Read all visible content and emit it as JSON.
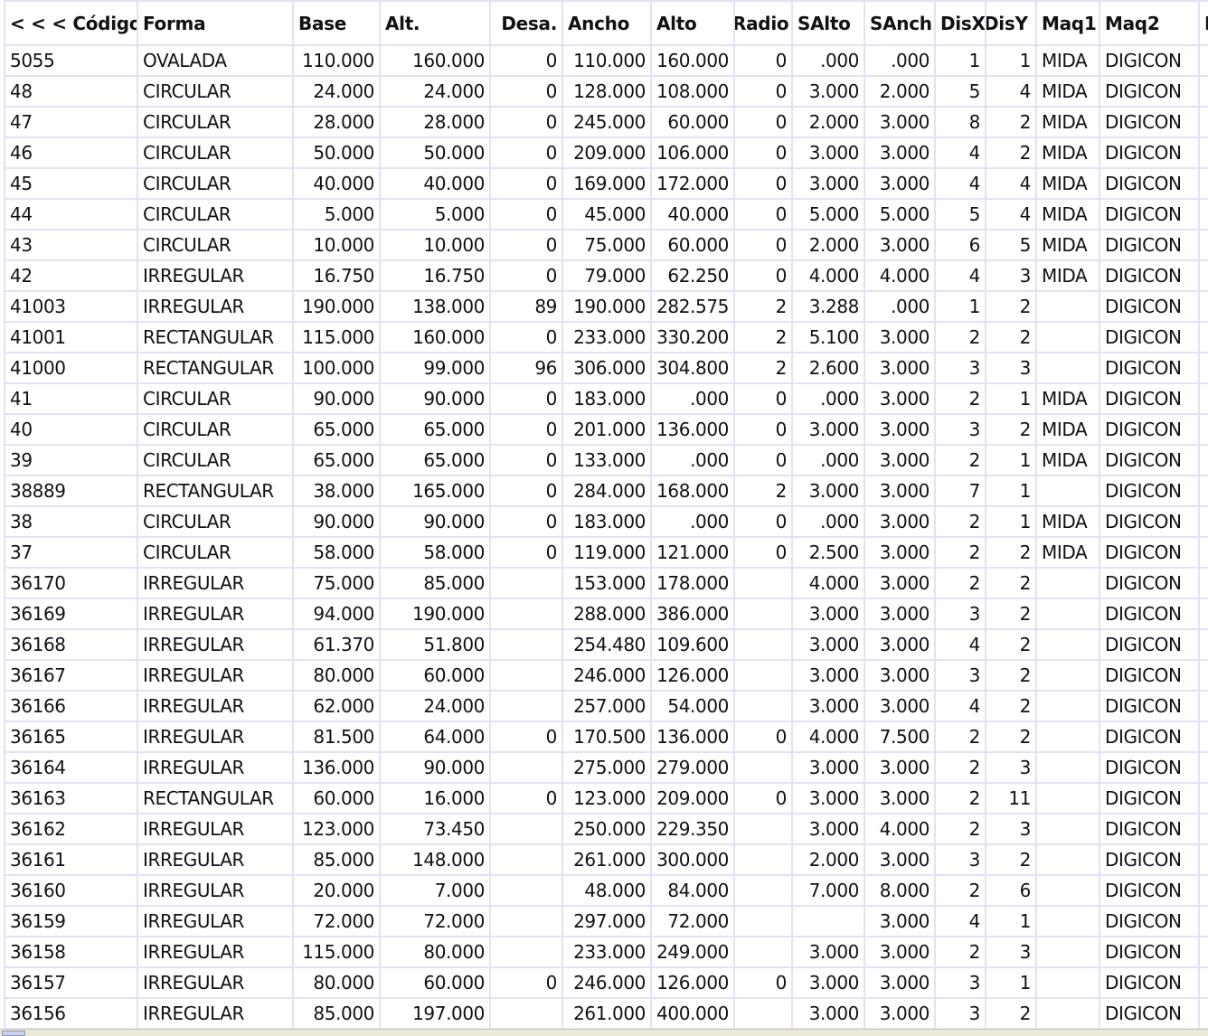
{
  "grid": {
    "columns": [
      {
        "label": "< < < Código",
        "align": "left"
      },
      {
        "label": "Forma",
        "align": "left"
      },
      {
        "label": "Base",
        "align": "left"
      },
      {
        "label": "Alt.",
        "align": "left"
      },
      {
        "label": "Desa.",
        "align": "right"
      },
      {
        "label": "Ancho",
        "align": "left"
      },
      {
        "label": "Alto",
        "align": "left"
      },
      {
        "label": "Radio",
        "align": "left"
      },
      {
        "label": "SAlto",
        "align": "left"
      },
      {
        "label": "SAnch",
        "align": "left"
      },
      {
        "label": "DisX",
        "align": "left"
      },
      {
        "label": "DisY",
        "align": "left"
      },
      {
        "label": "Maq1",
        "align": "left"
      },
      {
        "label": "Maq2",
        "align": "left"
      },
      {
        "label": "M",
        "align": "left"
      }
    ],
    "rows": [
      [
        "5055",
        "OVALADA",
        "110.000",
        "160.000",
        "0",
        "110.000",
        "160.000",
        "0",
        ".000",
        ".000",
        "1",
        "1",
        "MIDA",
        "DIGICON",
        ""
      ],
      [
        "48",
        "CIRCULAR",
        "24.000",
        "24.000",
        "0",
        "128.000",
        "108.000",
        "0",
        "3.000",
        "2.000",
        "5",
        "4",
        "MIDA",
        "DIGICON",
        ""
      ],
      [
        "47",
        "CIRCULAR",
        "28.000",
        "28.000",
        "0",
        "245.000",
        "60.000",
        "0",
        "2.000",
        "3.000",
        "8",
        "2",
        "MIDA",
        "DIGICON",
        ""
      ],
      [
        "46",
        "CIRCULAR",
        "50.000",
        "50.000",
        "0",
        "209.000",
        "106.000",
        "0",
        "3.000",
        "3.000",
        "4",
        "2",
        "MIDA",
        "DIGICON",
        ""
      ],
      [
        "45",
        "CIRCULAR",
        "40.000",
        "40.000",
        "0",
        "169.000",
        "172.000",
        "0",
        "3.000",
        "3.000",
        "4",
        "4",
        "MIDA",
        "DIGICON",
        ""
      ],
      [
        "44",
        "CIRCULAR",
        "5.000",
        "5.000",
        "0",
        "45.000",
        "40.000",
        "0",
        "5.000",
        "5.000",
        "5",
        "4",
        "MIDA",
        "DIGICON",
        ""
      ],
      [
        "43",
        "CIRCULAR",
        "10.000",
        "10.000",
        "0",
        "75.000",
        "60.000",
        "0",
        "2.000",
        "3.000",
        "6",
        "5",
        "MIDA",
        "DIGICON",
        ""
      ],
      [
        "42",
        "IRREGULAR",
        "16.750",
        "16.750",
        "0",
        "79.000",
        "62.250",
        "0",
        "4.000",
        "4.000",
        "4",
        "3",
        "MIDA",
        "DIGICON",
        ""
      ],
      [
        "41003",
        "IRREGULAR",
        "190.000",
        "138.000",
        "89",
        "190.000",
        "282.575",
        "2",
        "3.288",
        ".000",
        "1",
        "2",
        "",
        "DIGICON",
        ""
      ],
      [
        "41001",
        "RECTANGULAR",
        "115.000",
        "160.000",
        "0",
        "233.000",
        "330.200",
        "2",
        "5.100",
        "3.000",
        "2",
        "2",
        "",
        "DIGICON",
        ""
      ],
      [
        "41000",
        "RECTANGULAR",
        "100.000",
        "99.000",
        "96",
        "306.000",
        "304.800",
        "2",
        "2.600",
        "3.000",
        "3",
        "3",
        "",
        "DIGICON",
        ""
      ],
      [
        "41",
        "CIRCULAR",
        "90.000",
        "90.000",
        "0",
        "183.000",
        ".000",
        "0",
        ".000",
        "3.000",
        "2",
        "1",
        "MIDA",
        "DIGICON",
        ""
      ],
      [
        "40",
        "CIRCULAR",
        "65.000",
        "65.000",
        "0",
        "201.000",
        "136.000",
        "0",
        "3.000",
        "3.000",
        "3",
        "2",
        "MIDA",
        "DIGICON",
        ""
      ],
      [
        "39",
        "CIRCULAR",
        "65.000",
        "65.000",
        "0",
        "133.000",
        ".000",
        "0",
        ".000",
        "3.000",
        "2",
        "1",
        "MIDA",
        "DIGICON",
        ""
      ],
      [
        "38889",
        "RECTANGULAR",
        "38.000",
        "165.000",
        "0",
        "284.000",
        "168.000",
        "2",
        "3.000",
        "3.000",
        "7",
        "1",
        "",
        "DIGICON",
        ""
      ],
      [
        "38",
        "CIRCULAR",
        "90.000",
        "90.000",
        "0",
        "183.000",
        ".000",
        "0",
        ".000",
        "3.000",
        "2",
        "1",
        "MIDA",
        "DIGICON",
        ""
      ],
      [
        "37",
        "CIRCULAR",
        "58.000",
        "58.000",
        "0",
        "119.000",
        "121.000",
        "0",
        "2.500",
        "3.000",
        "2",
        "2",
        "MIDA",
        "DIGICON",
        ""
      ],
      [
        "36170",
        "IRREGULAR",
        "75.000",
        "85.000",
        "",
        "153.000",
        "178.000",
        "",
        "4.000",
        "3.000",
        "2",
        "2",
        "",
        "DIGICON",
        ""
      ],
      [
        "36169",
        "IRREGULAR",
        "94.000",
        "190.000",
        "",
        "288.000",
        "386.000",
        "",
        "3.000",
        "3.000",
        "3",
        "2",
        "",
        "DIGICON",
        ""
      ],
      [
        "36168",
        "IRREGULAR",
        "61.370",
        "51.800",
        "",
        "254.480",
        "109.600",
        "",
        "3.000",
        "3.000",
        "4",
        "2",
        "",
        "DIGICON",
        ""
      ],
      [
        "36167",
        "IRREGULAR",
        "80.000",
        "60.000",
        "",
        "246.000",
        "126.000",
        "",
        "3.000",
        "3.000",
        "3",
        "2",
        "",
        "DIGICON",
        ""
      ],
      [
        "36166",
        "IRREGULAR",
        "62.000",
        "24.000",
        "",
        "257.000",
        "54.000",
        "",
        "3.000",
        "3.000",
        "4",
        "2",
        "",
        "DIGICON",
        ""
      ],
      [
        "36165",
        "IRREGULAR",
        "81.500",
        "64.000",
        "0",
        "170.500",
        "136.000",
        "0",
        "4.000",
        "7.500",
        "2",
        "2",
        "",
        "DIGICON",
        ""
      ],
      [
        "36164",
        "IRREGULAR",
        "136.000",
        "90.000",
        "",
        "275.000",
        "279.000",
        "",
        "3.000",
        "3.000",
        "2",
        "3",
        "",
        "DIGICON",
        ""
      ],
      [
        "36163",
        "RECTANGULAR",
        "60.000",
        "16.000",
        "0",
        "123.000",
        "209.000",
        "0",
        "3.000",
        "3.000",
        "2",
        "11",
        "",
        "DIGICON",
        ""
      ],
      [
        "36162",
        "IRREGULAR",
        "123.000",
        "73.450",
        "",
        "250.000",
        "229.350",
        "",
        "3.000",
        "4.000",
        "2",
        "3",
        "",
        "DIGICON",
        ""
      ],
      [
        "36161",
        "IRREGULAR",
        "85.000",
        "148.000",
        "",
        "261.000",
        "300.000",
        "",
        "2.000",
        "3.000",
        "3",
        "2",
        "",
        "DIGICON",
        ""
      ],
      [
        "36160",
        "IRREGULAR",
        "20.000",
        "7.000",
        "",
        "48.000",
        "84.000",
        "",
        "7.000",
        "8.000",
        "2",
        "6",
        "",
        "DIGICON",
        ""
      ],
      [
        "36159",
        "IRREGULAR",
        "72.000",
        "72.000",
        "",
        "297.000",
        "72.000",
        "",
        "",
        "3.000",
        "4",
        "1",
        "",
        "DIGICON",
        ""
      ],
      [
        "36158",
        "IRREGULAR",
        "115.000",
        "80.000",
        "",
        "233.000",
        "249.000",
        "",
        "3.000",
        "3.000",
        "2",
        "3",
        "",
        "DIGICON",
        ""
      ],
      [
        "36157",
        "IRREGULAR",
        "80.000",
        "60.000",
        "0",
        "246.000",
        "126.000",
        "0",
        "3.000",
        "3.000",
        "3",
        "1",
        "",
        "DIGICON",
        ""
      ],
      [
        "36156",
        "IRREGULAR",
        "85.000",
        "197.000",
        "",
        "261.000",
        "400.000",
        "",
        "3.000",
        "3.000",
        "3",
        "2",
        "",
        "DIGICON",
        ""
      ]
    ]
  }
}
